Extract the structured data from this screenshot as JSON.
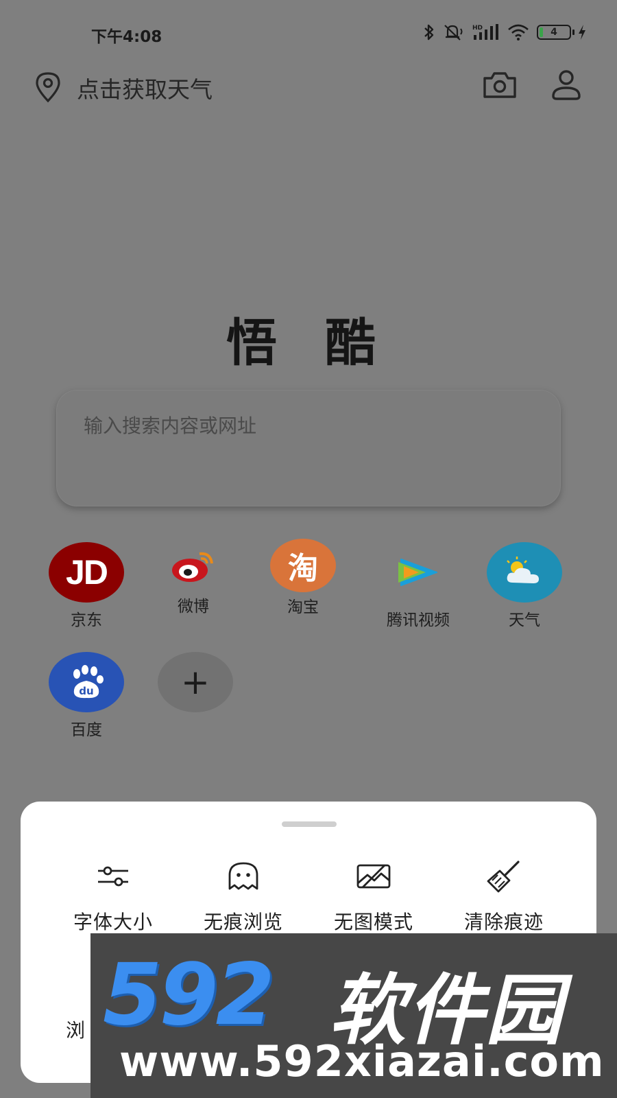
{
  "status_bar": {
    "time": "下午4:08",
    "battery_level": "4",
    "network": "HD"
  },
  "header": {
    "weather_prompt": "点击获取天气"
  },
  "brand": {
    "title": "悟 酷"
  },
  "search": {
    "placeholder": "输入搜索内容或网址"
  },
  "shortcuts": [
    {
      "label": "京东",
      "icon": "jd-logo-icon",
      "glyph": "JD",
      "color": "#8b0000"
    },
    {
      "label": "微博",
      "icon": "weibo-logo-icon",
      "color": "#c8161d"
    },
    {
      "label": "淘宝",
      "icon": "taobao-logo-icon",
      "glyph": "淘",
      "color": "#d9743a"
    },
    {
      "label": "腾讯视频",
      "icon": "tencent-video-logo-icon"
    },
    {
      "label": "天气",
      "icon": "weather-logo-icon",
      "color": "#1e8fb5"
    },
    {
      "label": "百度",
      "icon": "baidu-logo-icon",
      "glyph": "du",
      "color": "#2853b5"
    },
    {
      "label": "",
      "icon": "add-icon",
      "glyph": "+"
    }
  ],
  "menu": {
    "items": [
      {
        "label": "字体大小",
        "icon": "sliders-icon"
      },
      {
        "label": "无痕浏览",
        "icon": "ghost-icon"
      },
      {
        "label": "无图模式",
        "icon": "no-image-icon"
      },
      {
        "label": "清除痕迹",
        "icon": "broom-icon"
      }
    ],
    "partial_label": "浏"
  },
  "watermark": {
    "logo_number": "592",
    "logo_text": "软件园",
    "url": "www.592xiazai.com"
  }
}
